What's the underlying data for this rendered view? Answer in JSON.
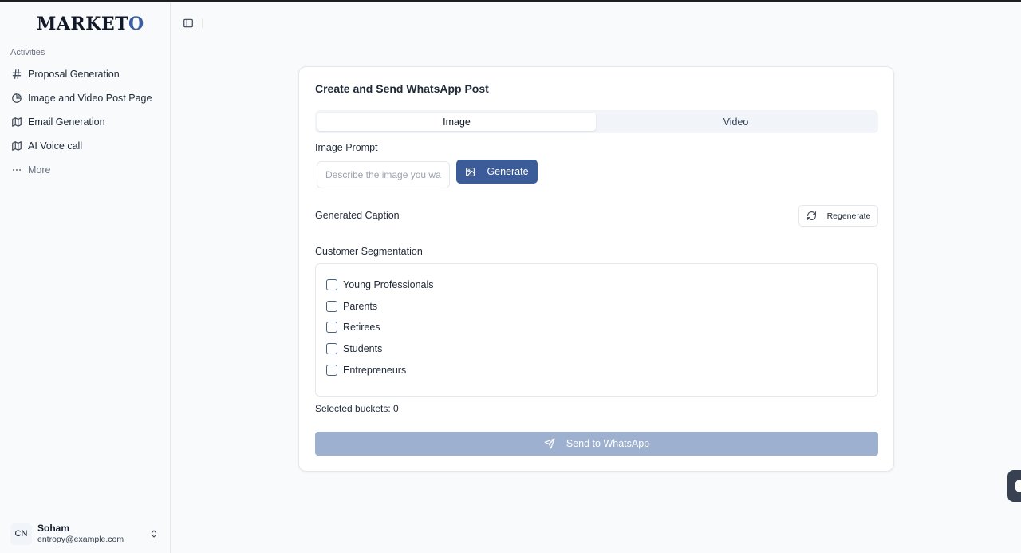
{
  "app": {
    "logo_main": "MARKET",
    "logo_accent": "O"
  },
  "sidebar": {
    "section_label": "Activities",
    "items": [
      {
        "label": "Proposal Generation",
        "icon": "hash-icon"
      },
      {
        "label": "Image and Video Post Page",
        "icon": "pie-chart-icon"
      },
      {
        "label": "Email Generation",
        "icon": "map-icon"
      },
      {
        "label": "AI Voice call",
        "icon": "map-icon"
      },
      {
        "label": "More",
        "icon": "ellipsis-icon"
      }
    ],
    "user": {
      "initials": "CN",
      "name": "Soham",
      "email": "entropy@example.com"
    }
  },
  "card": {
    "title": "Create and Send WhatsApp Post",
    "tabs": [
      {
        "label": "Image",
        "active": true
      },
      {
        "label": "Video",
        "active": false
      }
    ],
    "image_prompt_label": "Image Prompt",
    "image_prompt_placeholder": "Describe the image you want",
    "image_prompt_value": "",
    "generate_label": "Generate",
    "generated_caption_label": "Generated Caption",
    "regenerate_label": "Regenerate",
    "segmentation_label": "Customer Segmentation",
    "segments": [
      {
        "label": "Young Professionals",
        "checked": false
      },
      {
        "label": "Parents",
        "checked": false
      },
      {
        "label": "Retirees",
        "checked": false
      },
      {
        "label": "Students",
        "checked": false
      },
      {
        "label": "Entrepreneurs",
        "checked": false
      }
    ],
    "selected_buckets_text": "Selected buckets: 0",
    "send_label": "Send to WhatsApp"
  },
  "colors": {
    "primary": "#3b5c99",
    "primary_disabled": "#9db0cf",
    "logo_accent": "#3b5ea0"
  }
}
